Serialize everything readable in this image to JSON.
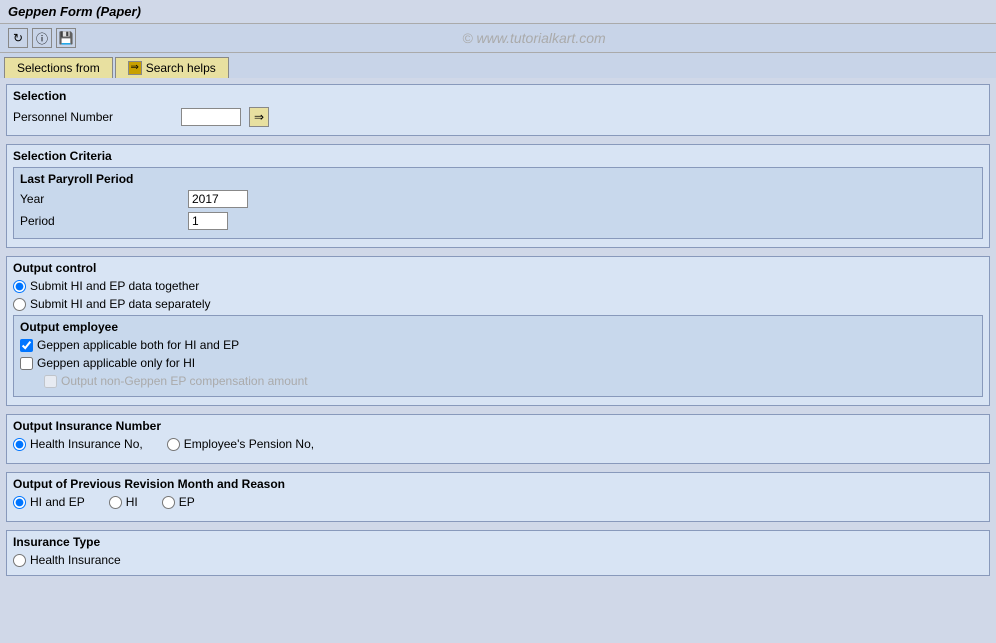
{
  "title": "Geppen Form (Paper)",
  "toolbar": {
    "icons": [
      "back-icon",
      "info-icon",
      "save-icon"
    ],
    "watermark": "© www.tutorialkart.com"
  },
  "tabs": {
    "selections_from": "Selections from",
    "search_helps": "Search helps"
  },
  "selection_section": {
    "label": "Selection",
    "fields": [
      {
        "label": "Personnel Number",
        "value": "",
        "placeholder": ""
      }
    ]
  },
  "selection_criteria": {
    "label": "Selection Criteria",
    "last_payroll_period": {
      "label": "Last Paryroll Period",
      "year_label": "Year",
      "year_value": "2017",
      "period_label": "Period",
      "period_value": "1"
    }
  },
  "output_control": {
    "label": "Output control",
    "radio_submit": [
      {
        "label": "Submit HI and EP data together",
        "checked": true
      },
      {
        "label": "Submit HI and EP data separately",
        "checked": false
      }
    ],
    "output_employee": {
      "label": "Output employee",
      "checkboxes": [
        {
          "label": "Geppen applicable both for HI and EP",
          "checked": true,
          "disabled": false
        },
        {
          "label": "Geppen applicable only for HI",
          "checked": false,
          "disabled": false
        },
        {
          "label": "Output non-Geppen EP compensation amount",
          "checked": false,
          "disabled": true
        }
      ]
    }
  },
  "output_insurance_number": {
    "label": "Output Insurance Number",
    "radios": [
      {
        "label": "Health Insurance No,",
        "checked": true
      },
      {
        "label": "Employee's Pension No,",
        "checked": false
      }
    ]
  },
  "output_previous_revision": {
    "label": "Output of Previous Revision Month and Reason",
    "radios": [
      {
        "label": "HI and EP",
        "checked": true
      },
      {
        "label": "HI",
        "checked": false
      },
      {
        "label": "EP",
        "checked": false
      }
    ]
  },
  "insurance_type": {
    "label": "Insurance Type",
    "radios": [
      {
        "label": "Health Insurance",
        "checked": false
      }
    ]
  }
}
